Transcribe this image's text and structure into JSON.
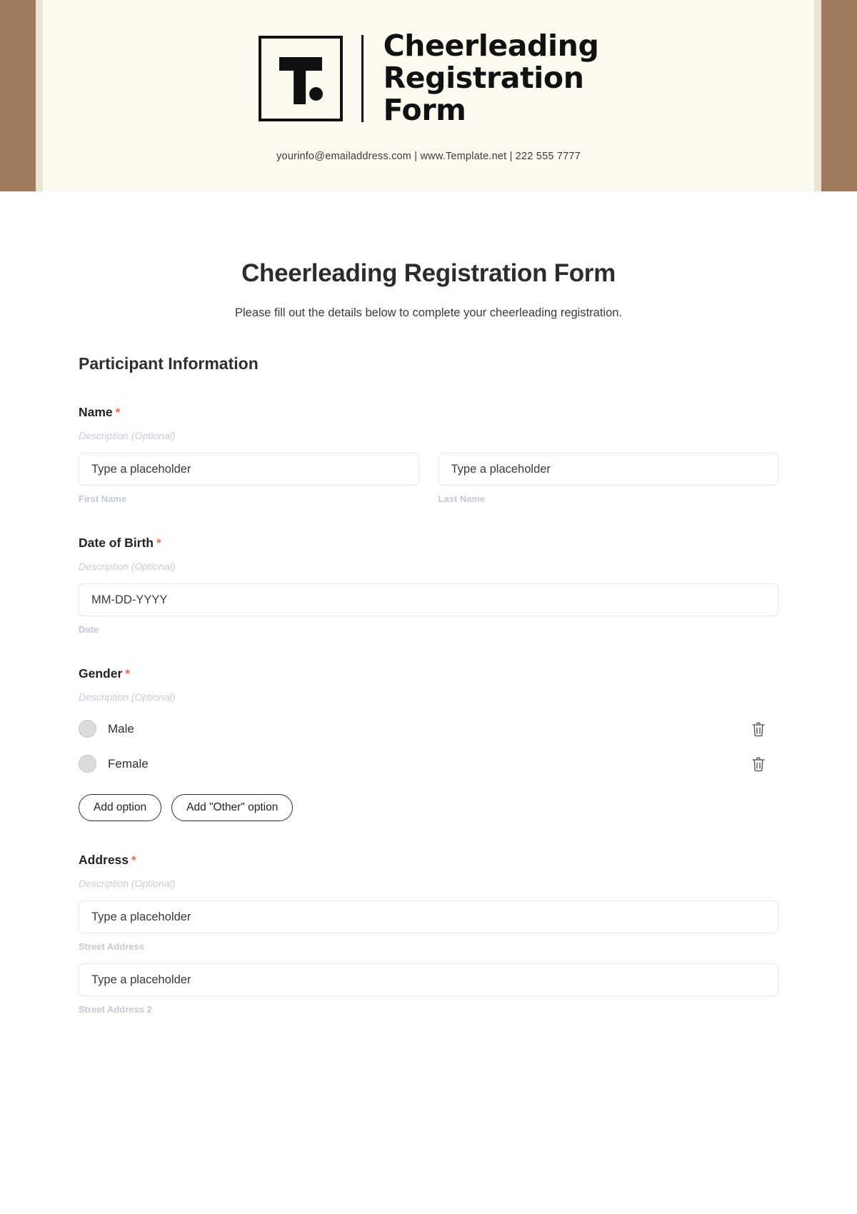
{
  "letterhead": {
    "logo_letter": "T",
    "title": "Cheerleading\nRegistration\nForm",
    "contact": "yourinfo@emailaddress.com  |  www.Template.net  |  222 555 7777",
    "accent_color": "#a17a5c",
    "paper_color": "#fdfaf0"
  },
  "form": {
    "title": "Cheerleading Registration Form",
    "subtitle": "Please fill out the details below to complete your cheerleading registration.",
    "section_heading": "Participant Information",
    "required_marker": "*",
    "description_placeholder": "Description (Optional)",
    "required_color": "#f4664a",
    "fields": {
      "name": {
        "label": "Name",
        "description": "Description (Optional)",
        "first": {
          "placeholder": "Type a placeholder",
          "sub_label": "First Name"
        },
        "last": {
          "placeholder": "Type a placeholder",
          "sub_label": "Last Name"
        }
      },
      "dob": {
        "label": "Date of Birth",
        "description": "Description (Optional)",
        "placeholder": "MM-DD-YYYY",
        "sub_label": "Date"
      },
      "gender": {
        "label": "Gender",
        "description": "Description (Optional)",
        "options": [
          {
            "label": "Male",
            "delete_icon": "trash-icon"
          },
          {
            "label": "Female",
            "delete_icon": "trash-icon"
          }
        ],
        "add_option_label": "Add option",
        "add_other_option_label": "Add \"Other\" option"
      },
      "address": {
        "label": "Address",
        "description": "Description (Optional)",
        "line1": {
          "placeholder": "Type a placeholder",
          "sub_label": "Street Address"
        },
        "line2": {
          "placeholder": "Type a placeholder",
          "sub_label": "Street Address 2"
        }
      }
    }
  }
}
